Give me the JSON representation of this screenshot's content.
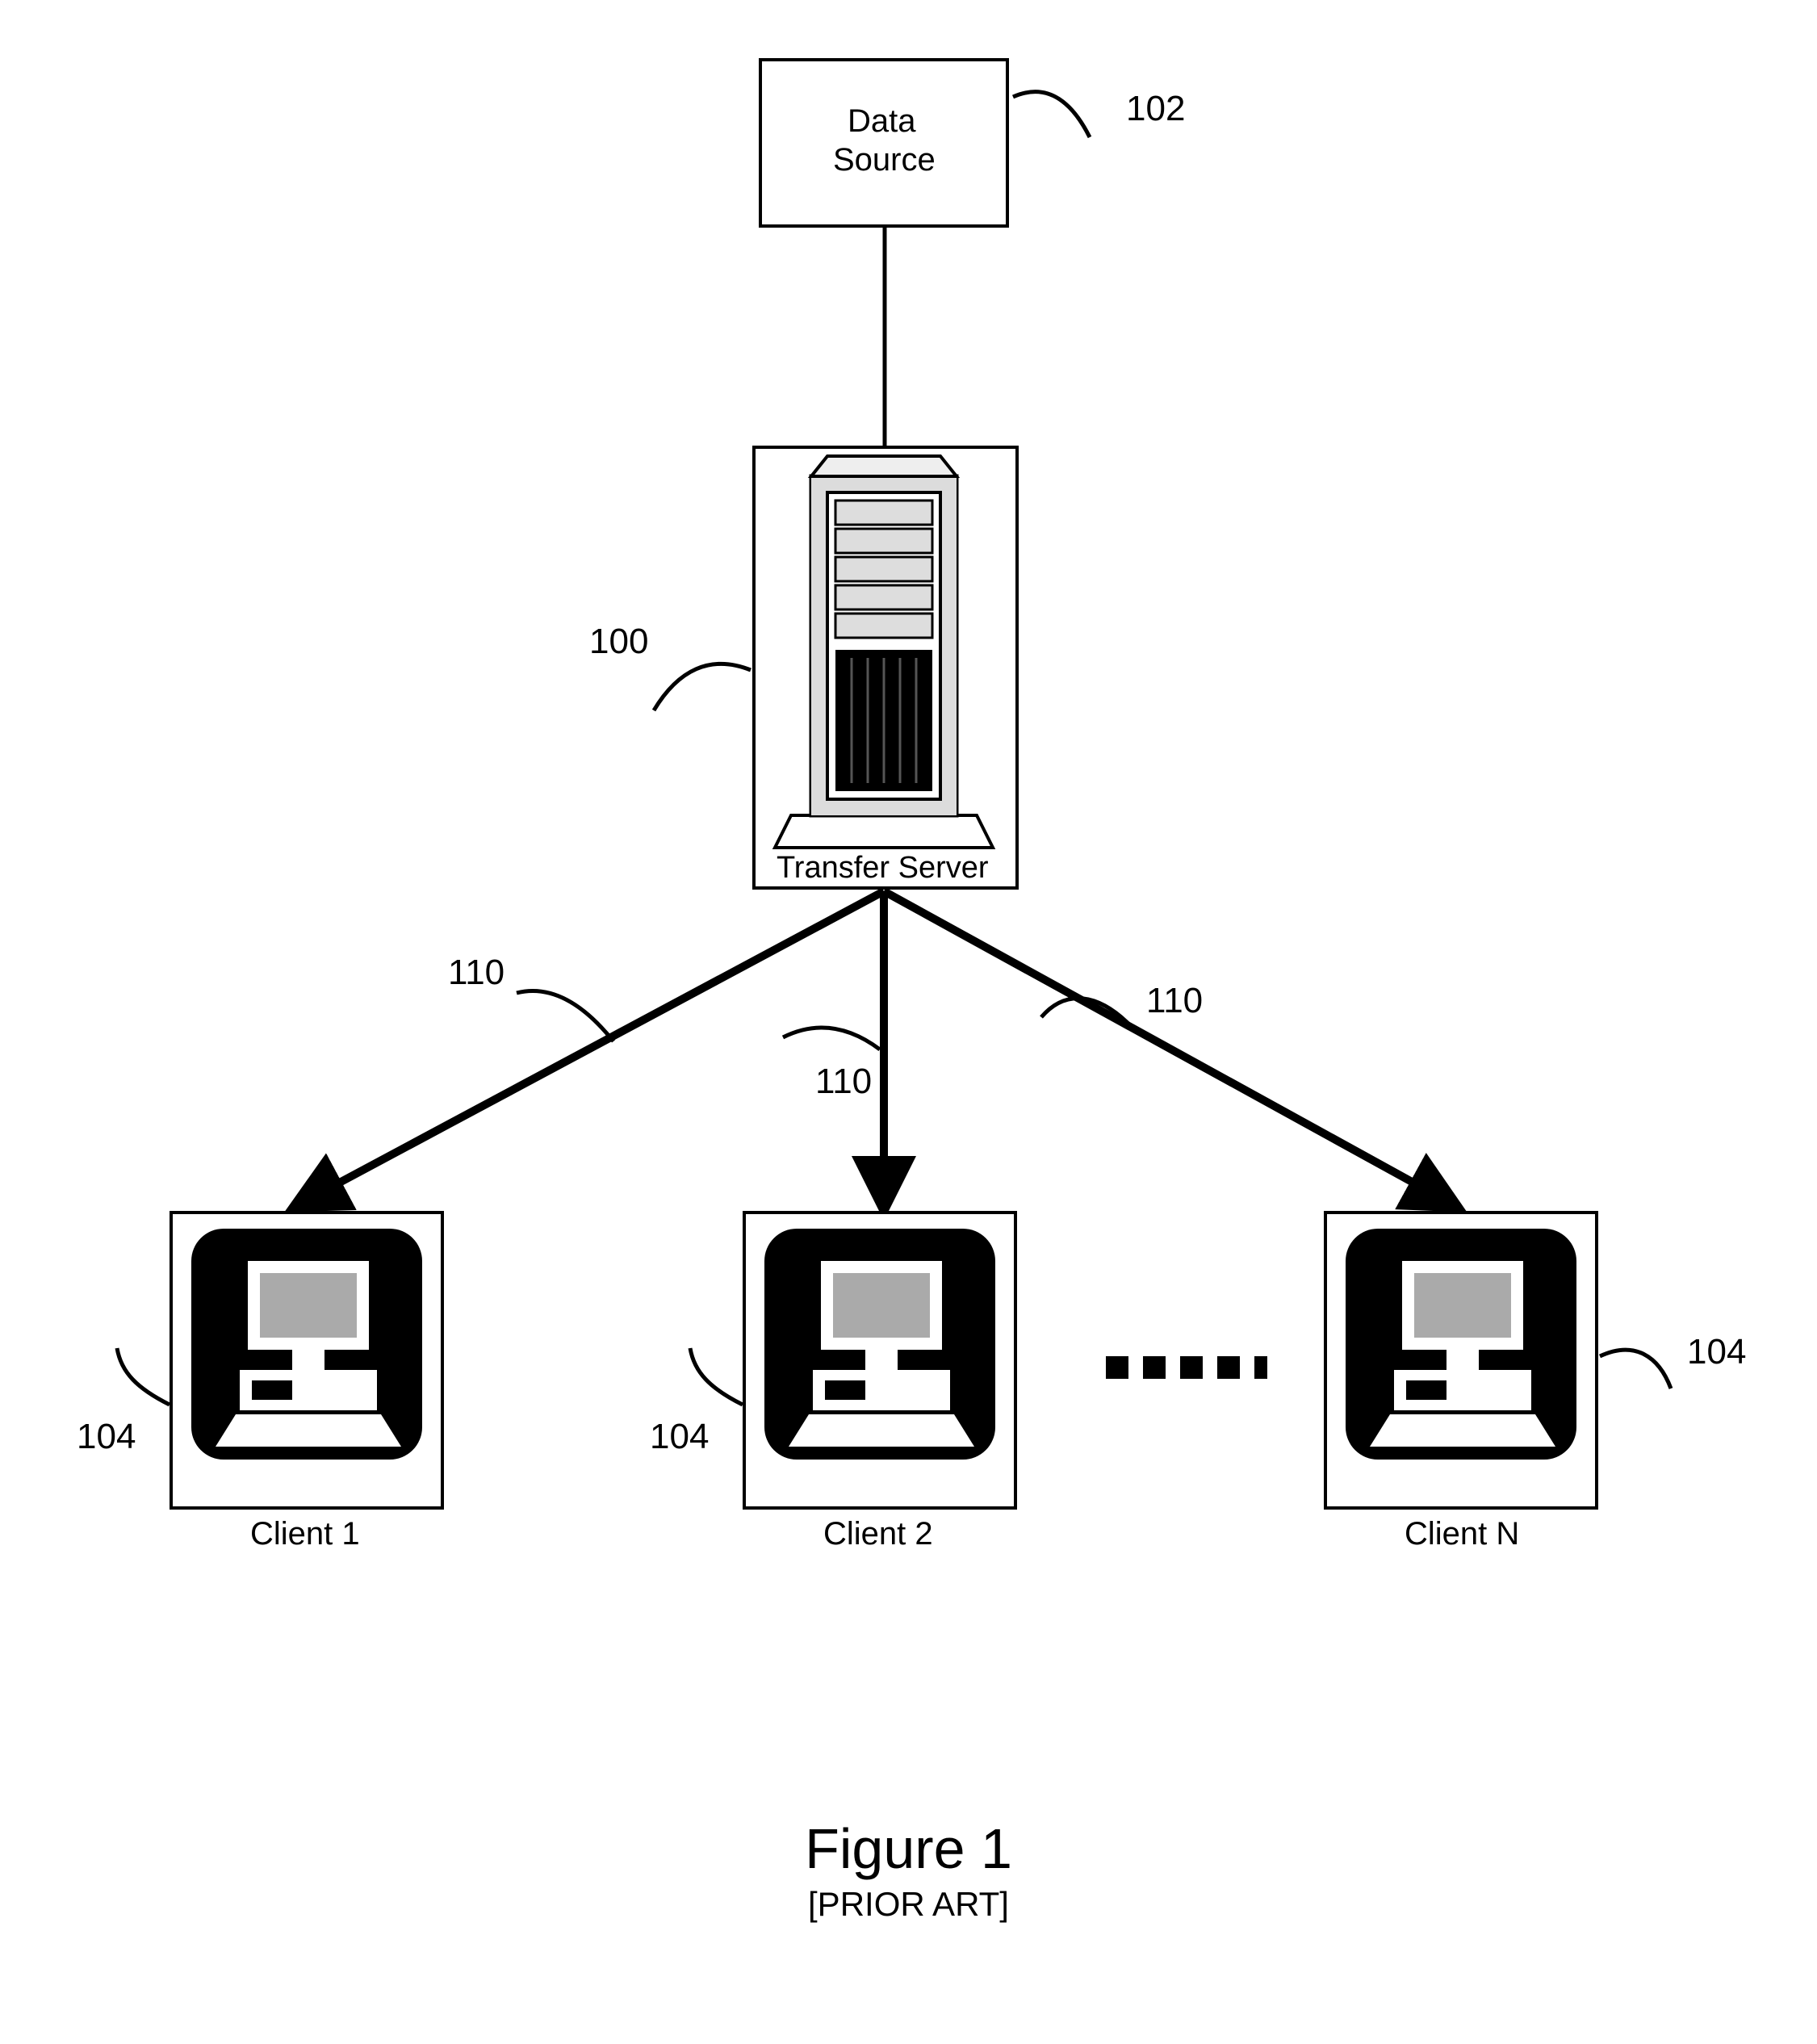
{
  "nodes": {
    "data_source": {
      "line1": "Data",
      "line2": "Source",
      "ref": "102"
    },
    "transfer_server": {
      "label": "Transfer Server",
      "ref": "100"
    },
    "client1": {
      "label": "Client 1",
      "ref": "104"
    },
    "client2": {
      "label": "Client 2",
      "ref": "104"
    },
    "clientN": {
      "label": "Client N",
      "ref": "104"
    }
  },
  "edges": {
    "arrow_refs": [
      "110",
      "110",
      "110"
    ]
  },
  "figure": {
    "title": "Figure 1",
    "subtitle": "[PRIOR ART]"
  }
}
